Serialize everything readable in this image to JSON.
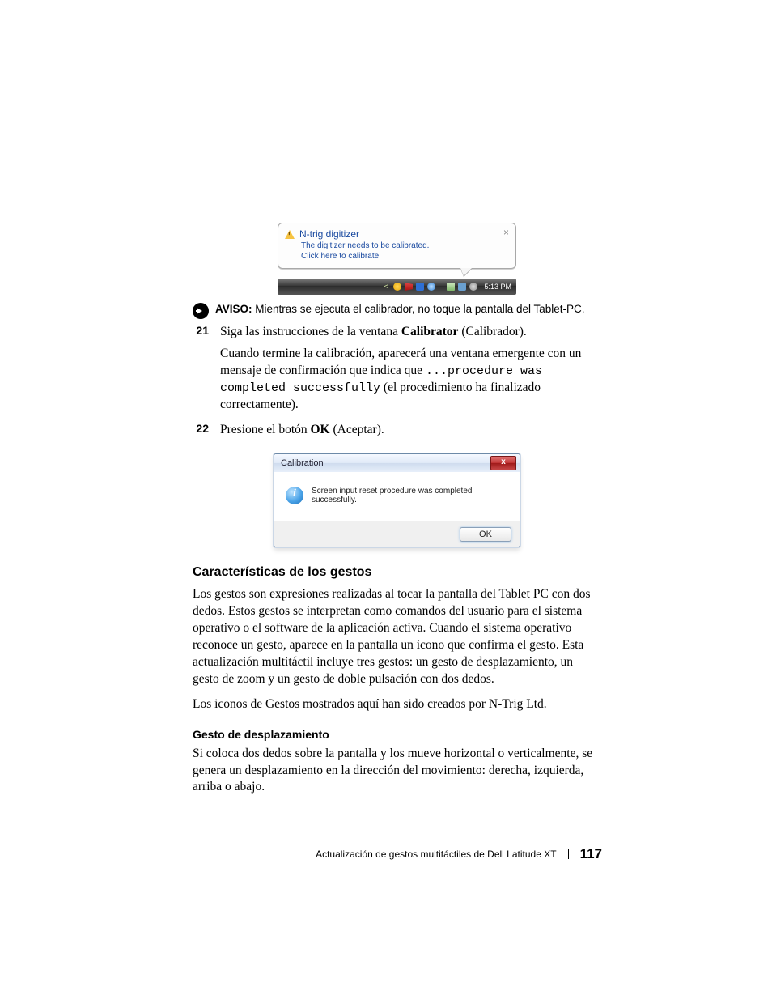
{
  "notification": {
    "title": "N-trig digitizer",
    "line1": "The digitizer needs to be calibrated.",
    "line2": "Click here to calibrate.",
    "close_glyph": "×"
  },
  "taskbar": {
    "chevron": "<",
    "time": "5:13 PM"
  },
  "aviso": {
    "label": "AVISO:",
    "text": " Mientras se ejecuta el calibrador, no toque la pantalla del Tablet-PC."
  },
  "step21": {
    "num": "21",
    "text_pre": "Siga las instrucciones de la ventana ",
    "bold": "Calibrator",
    "text_post": " (Calibrador)."
  },
  "step21_follow": {
    "part1": "Cuando termine la calibración, aparecerá una ventana emergente con un mensaje de confirmación que indica que ",
    "code": "...procedure was completed successfully",
    "part2": " (el procedimiento ha finalizado correctamente)."
  },
  "step22": {
    "num": "22",
    "text_pre": "Presione el botón ",
    "bold": "OK",
    "text_post": " (Aceptar)."
  },
  "dialog": {
    "title": "Calibration",
    "close_glyph": "x",
    "message": "Screen input reset procedure was completed successfully.",
    "ok_label": "OK"
  },
  "heading_features": "Características de los gestos",
  "para_features": "Los gestos son expresiones realizadas al tocar la pantalla del Tablet PC con dos dedos. Estos gestos se interpretan como comandos del usuario para el sistema operativo o el software de la aplicación activa. Cuando el sistema operativo reconoce un gesto, aparece en la pantalla un icono que confirma el gesto. Esta actualización multitáctil incluye tres gestos: un gesto de desplazamiento, un gesto de zoom y un gesto de doble pulsación con dos dedos.",
  "para_icons": "Los iconos de Gestos mostrados aquí han sido creados por N-Trig Ltd.",
  "heading_scroll": "Gesto de desplazamiento",
  "para_scroll": "Si coloca dos dedos sobre la pantalla y los mueve horizontal o verticalmente, se genera un desplazamiento en la dirección del movimiento: derecha, izquierda, arriba o abajo.",
  "footer": {
    "text": "Actualización de gestos multitáctiles de Dell Latitude XT",
    "page": "117"
  }
}
